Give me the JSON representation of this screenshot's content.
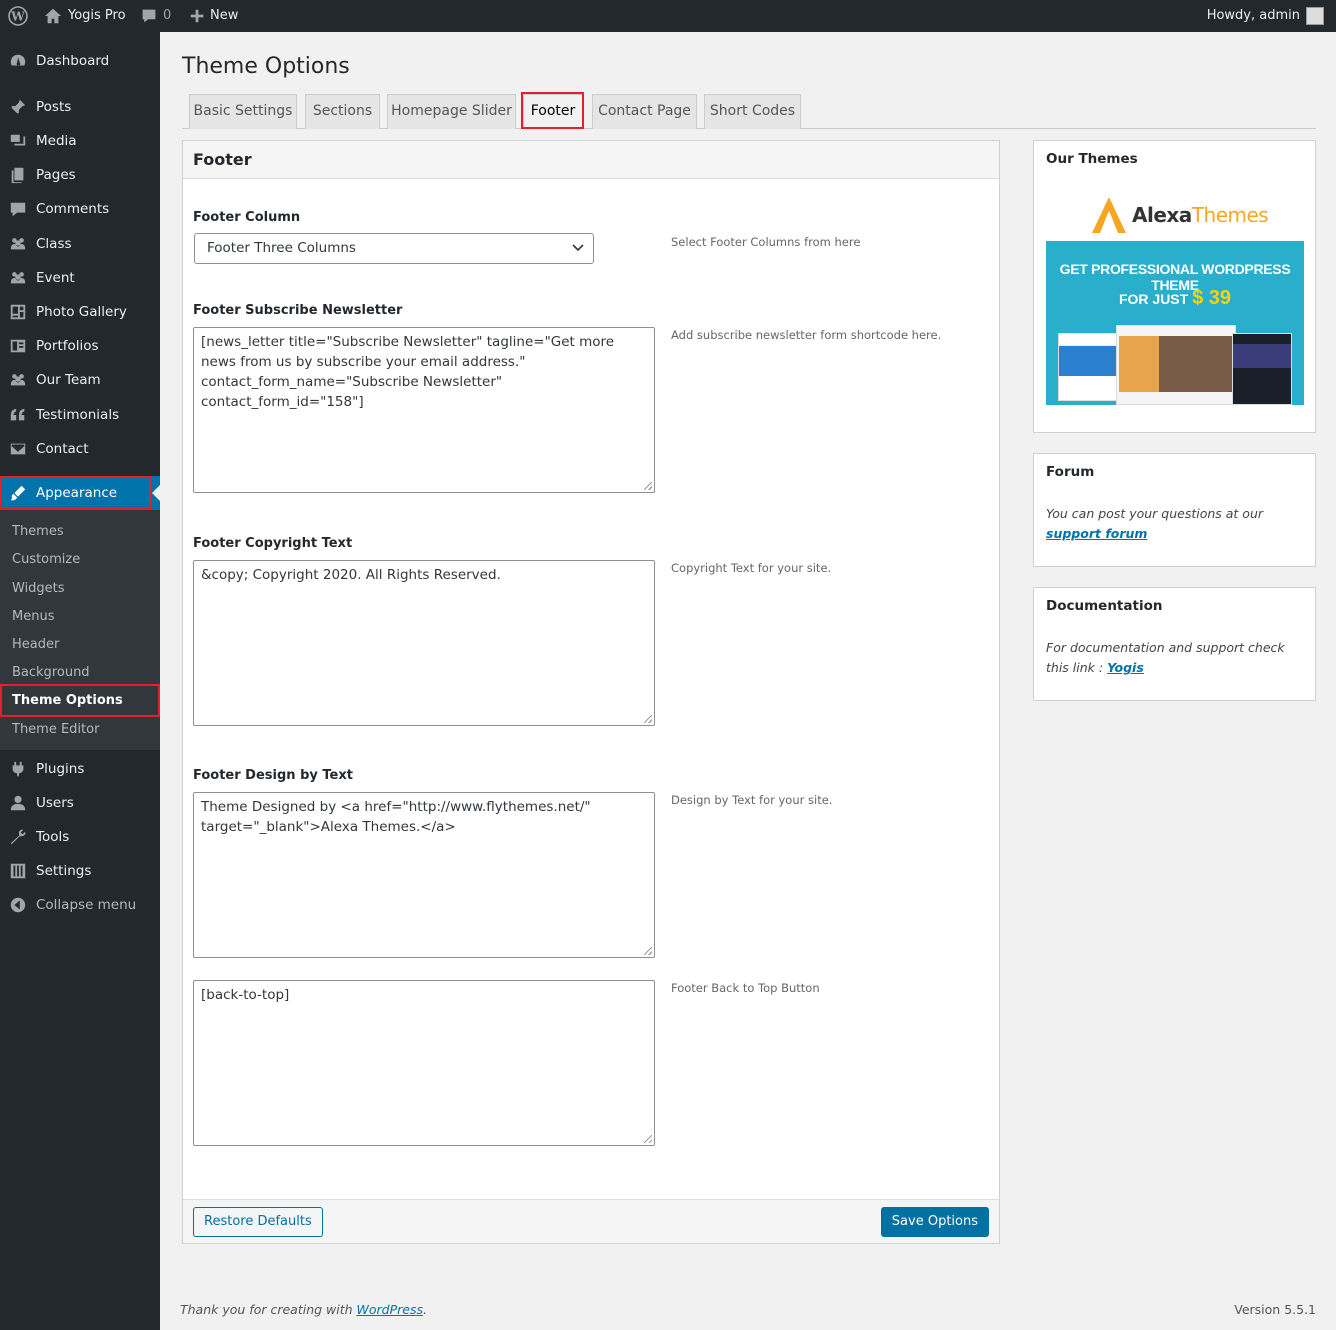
{
  "adminbar": {
    "site_name": "Yogis Pro",
    "comments_count": "0",
    "new_label": "New",
    "howdy": "Howdy, admin"
  },
  "sidebar": {
    "items": [
      {
        "label": "Dashboard",
        "icon": "dashboard-icon"
      },
      {
        "label": "Posts",
        "icon": "pin-icon"
      },
      {
        "label": "Media",
        "icon": "media-icon"
      },
      {
        "label": "Pages",
        "icon": "pages-icon"
      },
      {
        "label": "Comments",
        "icon": "comment-icon"
      },
      {
        "label": "Class",
        "icon": "groups-icon"
      },
      {
        "label": "Event",
        "icon": "groups-icon"
      },
      {
        "label": "Photo Gallery",
        "icon": "gallery-icon"
      },
      {
        "label": "Portfolios",
        "icon": "portfolio-icon"
      },
      {
        "label": "Our Team",
        "icon": "groups-icon"
      },
      {
        "label": "Testimonials",
        "icon": "quote-icon"
      },
      {
        "label": "Contact",
        "icon": "email-icon"
      },
      {
        "label": "Appearance",
        "icon": "brush-icon"
      },
      {
        "label": "Plugins",
        "icon": "plugin-icon"
      },
      {
        "label": "Users",
        "icon": "user-icon"
      },
      {
        "label": "Tools",
        "icon": "wrench-icon"
      },
      {
        "label": "Settings",
        "icon": "settings-icon"
      },
      {
        "label": "Collapse menu",
        "icon": "collapse-icon"
      }
    ],
    "submenu": [
      "Themes",
      "Customize",
      "Widgets",
      "Menus",
      "Header",
      "Background",
      "Theme Options",
      "Theme Editor"
    ]
  },
  "page": {
    "title": "Theme Options",
    "tabs": [
      "Basic Settings",
      "Sections",
      "Homepage Slider",
      "Footer",
      "Contact Page",
      "Short Codes"
    ],
    "active_tab": "Footer"
  },
  "panel": {
    "title": "Footer",
    "footer_column": {
      "label": "Footer Column",
      "value": "Footer Three Columns",
      "desc": "Select Footer Columns from here"
    },
    "newsletter": {
      "label": "Footer Subscribe Newsletter",
      "value": "[news_letter title=\"Subscribe Newsletter\" tagline=\"Get more news from us by subscribe your email address.\" contact_form_name=\"Subscribe Newsletter\" contact_form_id=\"158\"]",
      "desc": "Add subscribe newsletter form shortcode here."
    },
    "copyright": {
      "label": "Footer Copyright Text",
      "value": "&copy; Copyright 2020. All Rights Reserved.",
      "desc": "Copyright Text for your site."
    },
    "design_by": {
      "label": "Footer Design by Text",
      "value": "Theme Designed by <a href=\"http://www.flythemes.net/\" target=\"_blank\">Alexa Themes.</a>",
      "desc": "Design by Text for your site."
    },
    "back_to_top": {
      "value": "[back-to-top]",
      "desc": "Footer Back to Top Button"
    },
    "restore_label": "Restore Defaults",
    "save_label": "Save Options"
  },
  "widgets": {
    "themes": {
      "title": "Our Themes",
      "logo_main": "Alexa",
      "logo_accent": "Themes",
      "ad_line1": "GET PROFESSIONAL WORDPRESS THEME",
      "ad_line2": "FOR JUST",
      "ad_price": "$ 39"
    },
    "forum": {
      "title": "Forum",
      "text": "You can post your questions at our",
      "link": "support forum"
    },
    "docs": {
      "title": "Documentation",
      "text": "For documentation and support check this link :",
      "link": "Yogis"
    }
  },
  "footer": {
    "thanks_prefix": "Thank you for creating with",
    "thanks_link": "WordPress",
    "thanks_suffix": ".",
    "version": "Version 5.5.1"
  },
  "colors": {
    "accent": "#0073aa",
    "sidebar_bg": "#23282d",
    "highlight_box": "#e0202a"
  }
}
